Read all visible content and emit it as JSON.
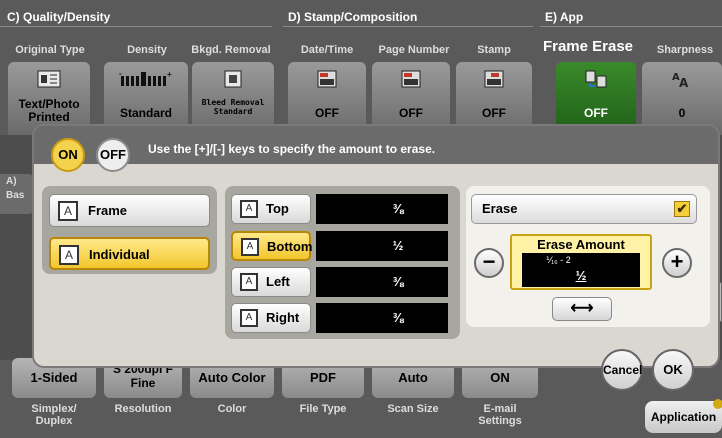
{
  "colors": {
    "accent_yellow": "#f3d34c",
    "selected_green": "#2e7a22",
    "panel_bg": "#d9d7d0"
  },
  "top": {
    "sections": [
      {
        "title": "C)  Quality/Density"
      },
      {
        "title": "D)  Stamp/Composition"
      },
      {
        "title": "E)  App"
      }
    ],
    "tabs": [
      {
        "header": "Original Type",
        "value": "Text/Photo Printed",
        "icon": "original-type-icon"
      },
      {
        "header": "Density",
        "value": "Standard",
        "icon": "density-slider-icon"
      },
      {
        "header": "Bkgd. Removal",
        "value": "Bleed Removal Standard",
        "icon": "background-removal-icon"
      },
      {
        "header": "Date/Time",
        "value": "OFF",
        "icon": "date-time-stamp-icon"
      },
      {
        "header": "Page Number",
        "value": "OFF",
        "icon": "page-number-stamp-icon"
      },
      {
        "header": "Stamp",
        "value": "OFF",
        "icon": "stamp-icon"
      },
      {
        "header": "Frame Erase",
        "value": "OFF",
        "icon": "frame-erase-icon"
      },
      {
        "header": "Sharpness",
        "value": "0",
        "icon": "sharpness-icon"
      }
    ]
  },
  "dialog": {
    "on_label": "ON",
    "off_label": "OFF",
    "instruction": "Use the [+]/[-] keys to specify the amount to erase.",
    "frame_label": "Frame",
    "individual_label": "Individual",
    "edges": [
      {
        "label": "Top",
        "value": "3/8",
        "glyph": "⅜"
      },
      {
        "label": "Bottom",
        "value": "1/2",
        "glyph": "½"
      },
      {
        "label": "Left",
        "value": "3/8",
        "glyph": "⅜"
      },
      {
        "label": "Right",
        "value": "3/8",
        "glyph": "⅜"
      }
    ],
    "erase_label": "Erase",
    "erase_amount_title": "Erase Amount",
    "erase_range": "1/16 - 2",
    "erase_range_text": "⅟₁₆ - 2",
    "erase_current": "1/2",
    "erase_current_glyph": "½",
    "minus": "−",
    "plus": "+",
    "swap_arrow": "⟷",
    "cancel_label": "Cancel",
    "ok_label": "OK"
  },
  "left_stub": {
    "line1": "A)",
    "line2": "Bas"
  },
  "bottom": {
    "tiles": [
      {
        "value": "1-Sided",
        "label": "Simplex/ Duplex"
      },
      {
        "value": "S 200dpi F Fine",
        "label": "Resolution"
      },
      {
        "value": "Auto Color",
        "label": "Color"
      },
      {
        "value": "PDF",
        "label": "File Type"
      },
      {
        "value": "Auto",
        "label": "Scan Size"
      },
      {
        "value": "ON",
        "label": "E-mail Settings"
      }
    ],
    "application_label": "Application"
  }
}
